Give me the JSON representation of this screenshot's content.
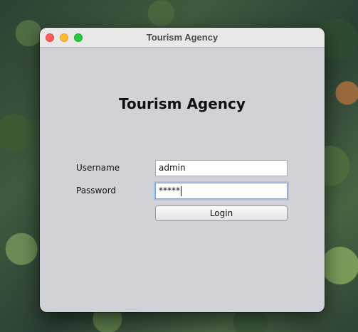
{
  "window": {
    "title": "Tourism Agency"
  },
  "form": {
    "heading": "Tourism Agency",
    "username_label": "Username",
    "username_value": "admin",
    "password_label": "Password",
    "password_masked": "*****",
    "login_label": "Login"
  },
  "colors": {
    "window_bg": "#d0d2d8",
    "close": "#fe5f57",
    "minimize": "#febc2e",
    "maximize": "#28c840",
    "focus_ring": "#a9c4e3"
  },
  "icons": {
    "close": "close-traffic-light-icon",
    "minimize": "minimize-traffic-light-icon",
    "maximize": "maximize-traffic-light-icon"
  }
}
